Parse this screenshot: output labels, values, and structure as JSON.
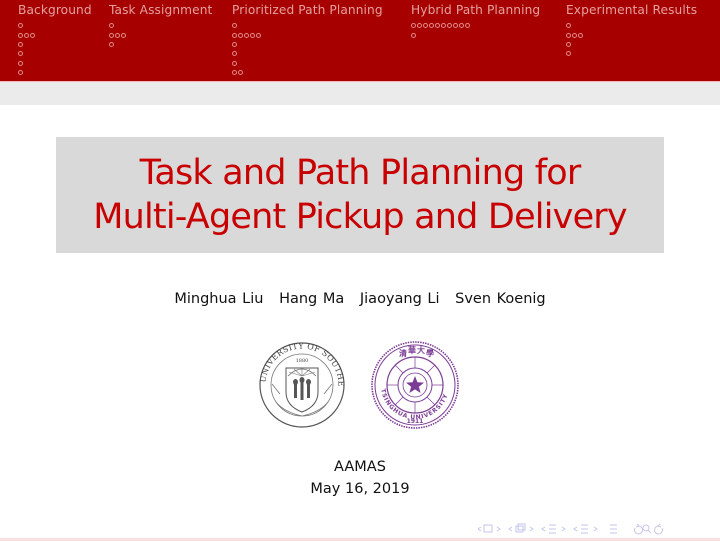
{
  "header": {
    "sections": [
      {
        "label": "Background",
        "dot_rows": [
          1,
          3,
          1,
          1,
          1,
          1
        ]
      },
      {
        "label": "Task Assignment",
        "dot_rows": [
          1,
          3,
          1
        ]
      },
      {
        "label": "Prioritized Path Planning",
        "dot_rows": [
          1,
          5,
          1,
          1,
          1,
          2
        ]
      },
      {
        "label": "Hybrid Path Planning",
        "dot_rows": [
          10,
          1
        ]
      },
      {
        "label": "Experimental Results",
        "dot_rows": [
          1,
          3,
          1,
          1
        ]
      }
    ]
  },
  "title": {
    "line1": "Task and Path Planning for",
    "line2": "Multi-Agent Pickup and Delivery"
  },
  "authors": [
    "Minghua Liu",
    "Hang Ma",
    "Jiaoyang Li",
    "Sven Koenig"
  ],
  "logos": {
    "usc": {
      "ring_text": "UNIVERSITY OF SOUTHERN CALIFORNIA",
      "year": "1880"
    },
    "tsinghua": {
      "ring_text": "TSINGHUA UNIVERSITY",
      "year": "1911",
      "color": "#7b3c95"
    }
  },
  "event": {
    "name": "AAMAS",
    "date": "May 16, 2019"
  },
  "colors": {
    "header_bg": "#a60000",
    "title_text": "#c80000",
    "title_box": "#d9d9d9"
  },
  "nav": {
    "icons": [
      "frame-prev",
      "frame-next",
      "subsection-prev",
      "subsection-next",
      "section-prev",
      "section-next",
      "slide-prev",
      "slide-next",
      "align",
      "search",
      "back",
      "forward"
    ]
  }
}
